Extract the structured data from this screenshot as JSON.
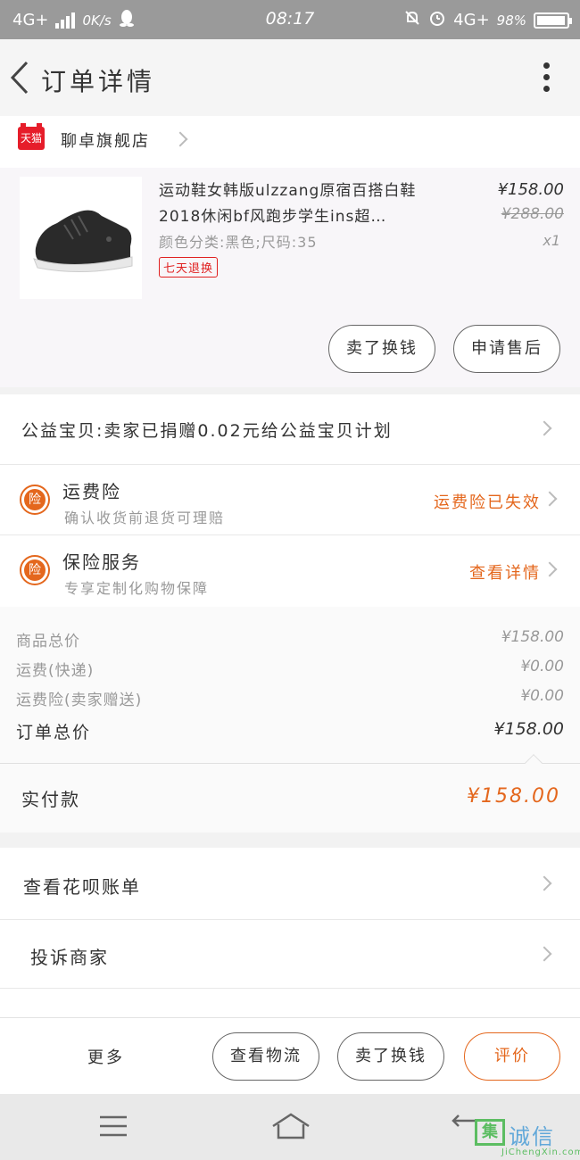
{
  "status_bar": {
    "network_left": "4G+",
    "speed": "0K/s",
    "time": "08:17",
    "network_right": "4G+",
    "battery": "98%",
    "battery_level": 0.98
  },
  "header": {
    "title": "订单详情"
  },
  "store": {
    "badge": "天猫",
    "name": "聊卓旗舰店"
  },
  "product": {
    "name": "运动鞋女韩版ulzzang原宿百搭白鞋2018休闲bf风跑步学生ins超…",
    "spec": "颜色分类:黑色;尺码:35",
    "badge": "七天退换",
    "price": "¥158.00",
    "original_price": "¥288.00",
    "quantity": "x1",
    "buttons": [
      "卖了换钱",
      "申请售后"
    ]
  },
  "charity": {
    "text": "公益宝贝:卖家已捐赠0.02元给公益宝贝计划"
  },
  "insurance": [
    {
      "icon": "险",
      "title": "运费险",
      "subtitle": "确认收货前退货可理赔",
      "status": "运费险已失效"
    },
    {
      "icon": "险",
      "title": "保险服务",
      "subtitle": "专享定制化购物保障",
      "status": "查看详情"
    }
  ],
  "summary": {
    "rows": [
      {
        "label": "商品总价",
        "value": "¥158.00"
      },
      {
        "label": "运费(快递)",
        "value": "¥0.00"
      },
      {
        "label": "运费险(卖家赠送)",
        "value": "¥0.00"
      }
    ],
    "total_label": "订单总价",
    "total_value": "¥158.00"
  },
  "payment": {
    "label": "实付款",
    "value": "¥158.00"
  },
  "links": [
    {
      "label": "查看花呗账单"
    },
    {
      "label": "投诉商家"
    }
  ],
  "action_bar": {
    "more": "更多",
    "buttons": [
      "查看物流",
      "卖了换钱",
      "评价"
    ]
  },
  "watermark": {
    "main": "集诚信",
    "sub": "JiChengXin.com"
  },
  "colors": {
    "accent": "#e4671d",
    "tmall_red": "#e61d2a",
    "status_gray": "#9a9a9a"
  }
}
